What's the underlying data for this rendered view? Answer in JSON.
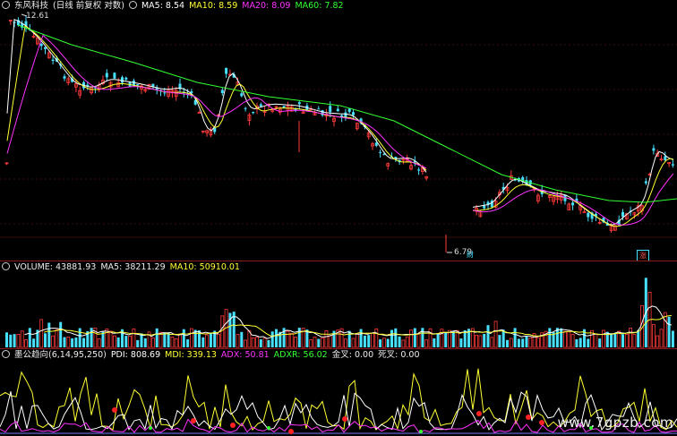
{
  "price_header": {
    "stock": "东风科技",
    "mode": "(日线 前复权 对数)",
    "ma5": "MA5: 8.54",
    "ma10": "MA10: 8.59",
    "ma20": "MA20: 8.09",
    "ma60": "MA60: 7.82"
  },
  "volume_header": {
    "name": "VOLUME: 43881.93",
    "ma5": "MA5: 38211.29",
    "ma10": "MA10: 50910.01"
  },
  "indicator_header": {
    "name": "墨公趋向(6,14,95,250)",
    "pdi": "PDI: 808.69",
    "mdi": "MDI: 339.13",
    "adx": "ADX: 50.81",
    "adxr": "ADXR: 56.02",
    "golden": "金叉: 0.00",
    "death": "死叉: 0.00"
  },
  "annotations": {
    "high": "12.61",
    "low": "6.79",
    "cai_tag": "财",
    "zhang_tag": "涨"
  },
  "watermark": "www.7gpzb.com",
  "colors": {
    "up": "#ff3b3b",
    "down": "#48e0ff",
    "ma5": "#ffffff",
    "ma10": "#ffff33",
    "ma20": "#ff33ff",
    "ma60": "#33ff33",
    "adx": "#ff33ff",
    "adxr": "#33ff33",
    "pdi": "#ffffff",
    "mdi": "#ffff33",
    "separator": "#8a1a1a"
  }
}
